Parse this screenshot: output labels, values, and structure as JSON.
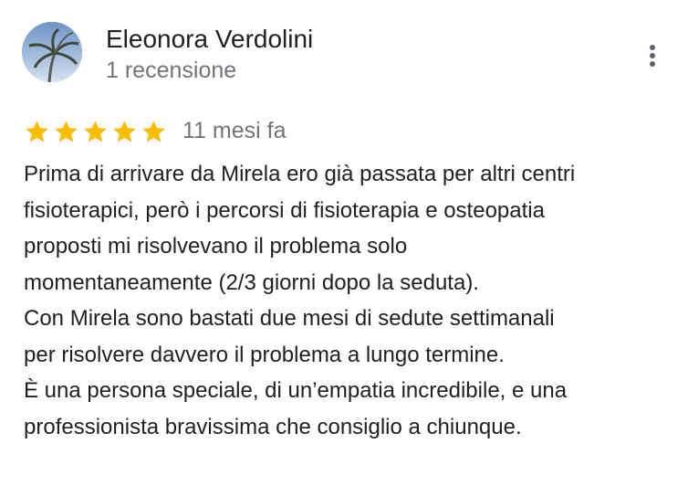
{
  "reviewer": {
    "name": "Eleonora Verdolini",
    "meta": "1 recensione",
    "avatar": "palm-tree-photo"
  },
  "more_options": {
    "icon": "more-vert-icon"
  },
  "rating": {
    "value": 5,
    "max": 5,
    "icon": "star-icon",
    "star_color": "#fbbc04"
  },
  "date": "11 mesi fa",
  "review_text_lines": [
    "Prima di arrivare da Mirela ero già passata per altri centri",
    "fisioterapici, però i percorsi di fisioterapia e osteopatia",
    "proposti mi risolvevano il problema solo",
    "momentaneamente (2/3 giorni dopo la seduta).",
    "Con Mirela sono bastati due mesi di sedute settimanali",
    "per risolvere davvero il problema a lungo termine.",
    "È una persona speciale, di un’empatia incredibile, e una",
    "professionista bravissima che consiglio a chiunque."
  ]
}
